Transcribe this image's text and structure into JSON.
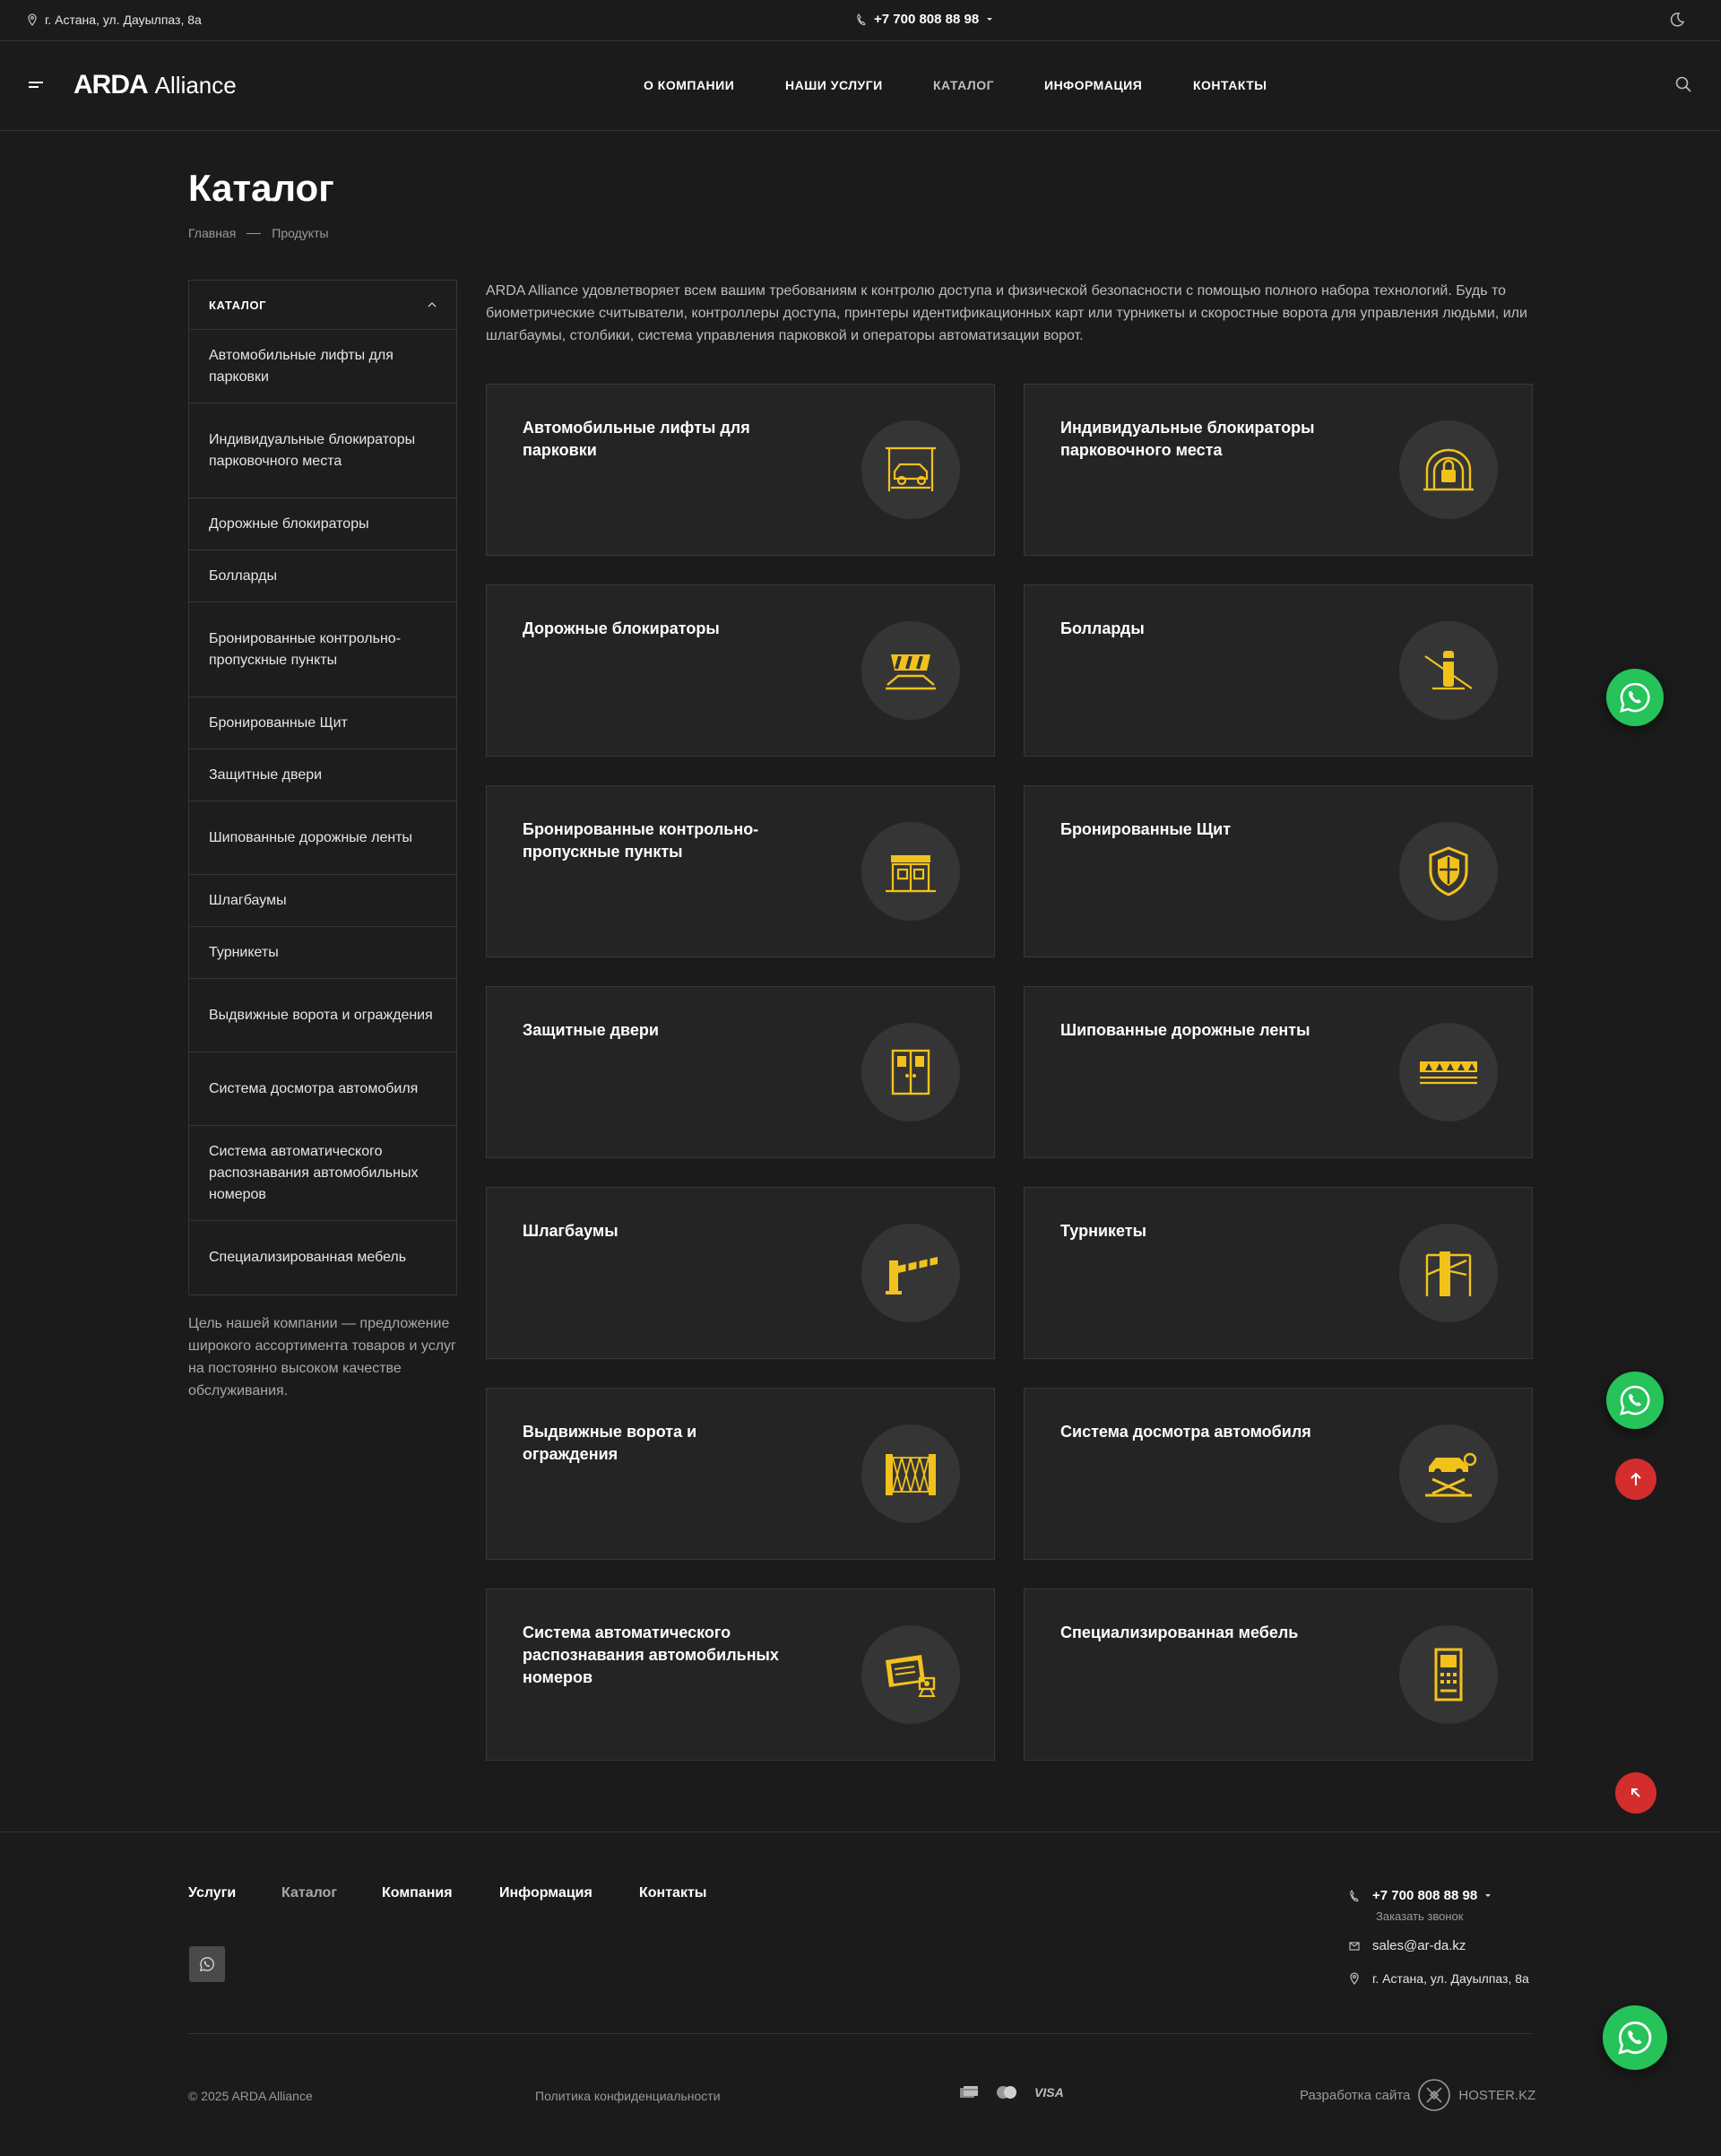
{
  "topbar": {
    "address": "г. Астана, ул. Дауылпаз, 8а",
    "phone": "+7 700 808 88 98"
  },
  "header": {
    "logo_main": "ARDA",
    "logo_sub": "Alliance",
    "nav": [
      "О КОМПАНИИ",
      "НАШИ УСЛУГИ",
      "КАТАЛОГ",
      "ИНФОРМАЦИЯ",
      "КОНТАКТЫ"
    ]
  },
  "page": {
    "title": "Каталог",
    "breadcrumb": [
      "Главная",
      "Продукты"
    ]
  },
  "sidebar": {
    "heading": "КАТАЛОГ",
    "items": [
      "Автомобильные лифты для парковки",
      "Индивидуальные блокираторы парковочного места",
      "Дорожные блокираторы",
      "Болларды",
      "Бронированные контрольно-пропускные пункты",
      "Бронированные Щит",
      "Защитные двери",
      "Шипованные дорожные ленты",
      "Шлагбаумы",
      "Турникеты",
      "Выдвижные ворота и ограждения",
      "Система досмотра автомобиля",
      "Система автоматического распознавания автомобильных номеров",
      "Специализированная мебель"
    ],
    "note": "Цель нашей компании — предложение широкого ассортимента товаров и услуг на постоянно высоком качестве обслуживания."
  },
  "intro": "ARDA Alliance удовлетворяет всем вашим требованиям к контролю доступа и физической безопасности с помощью полного набора технологий. Будь то биометрические считыватели, контроллеры доступа, принтеры идентификационных карт или турникеты и скоростные ворота для управления людьми, или шлагбаумы, столбики, система управления парковкой и операторы автоматизации ворот.",
  "cards": [
    {
      "title": "Автомобильные лифты для парковки",
      "icon": "car-lift-icon"
    },
    {
      "title": "Индивидуальные блокираторы парковочного места",
      "icon": "parking-lock-icon"
    },
    {
      "title": "Дорожные блокираторы",
      "icon": "road-blocker-icon"
    },
    {
      "title": "Болларды",
      "icon": "bollard-icon"
    },
    {
      "title": "Бронированные контрольно-пропускные пункты",
      "icon": "checkpoint-booth-icon"
    },
    {
      "title": "Бронированные Щит",
      "icon": "shield-icon"
    },
    {
      "title": "Защитные двери",
      "icon": "security-door-icon"
    },
    {
      "title": "Шипованные дорожные ленты",
      "icon": "spike-strip-icon"
    },
    {
      "title": "Шлагбаумы",
      "icon": "barrier-gate-icon"
    },
    {
      "title": "Турникеты",
      "icon": "turnstile-icon"
    },
    {
      "title": "Выдвижные ворота и ограждения",
      "icon": "sliding-gate-icon"
    },
    {
      "title": "Система досмотра автомобиля",
      "icon": "vehicle-inspection-icon"
    },
    {
      "title": "Система автоматического распознавания автомобильных номеров",
      "icon": "plate-recognition-icon"
    },
    {
      "title": "Специализированная мебель",
      "icon": "special-furniture-icon"
    }
  ],
  "footer": {
    "nav": [
      "Услуги",
      "Каталог",
      "Компания",
      "Информация",
      "Контакты"
    ],
    "phone": "+7 700 808 88 98",
    "callback": "Заказать звонок",
    "email": "sales@ar-da.kz",
    "address": "г. Астана, ул. Дауылпаз, 8а",
    "copyright": "© 2025 ARDA Alliance",
    "policy": "Политика конфиденциальности",
    "visa": "VISA",
    "dev_label": "Разработка сайта",
    "dev_name": "HOSTER.KZ"
  },
  "colors": {
    "background": "#1b1b1c",
    "card": "#242425",
    "accent_icon": "#f2c21b",
    "whatsapp": "#25c35a",
    "red_button": "#d42d2d"
  }
}
